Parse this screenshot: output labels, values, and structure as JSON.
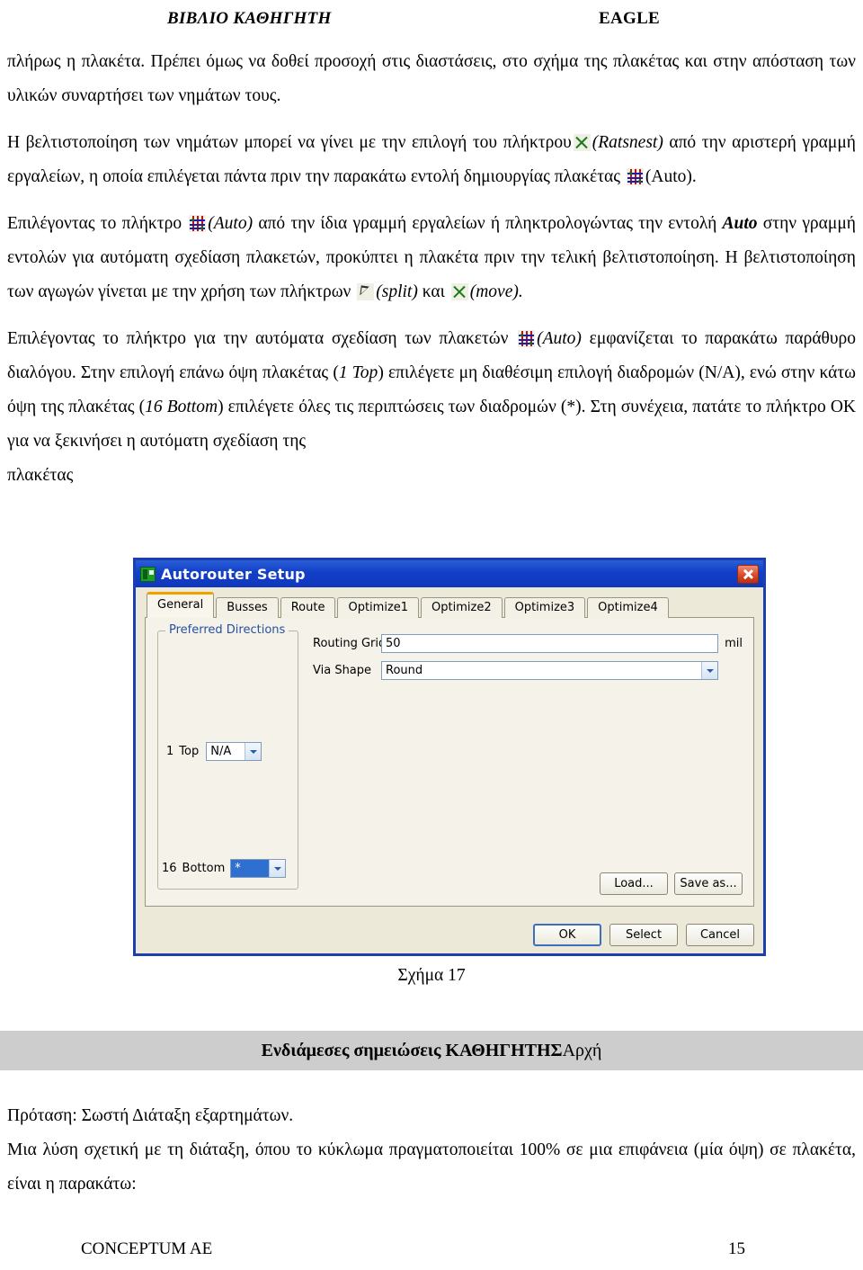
{
  "header": {
    "left": "ΒΙΒΛΙΟ ΚΑΘΗΓΗΤΗ",
    "right": "EAGLE"
  },
  "body": {
    "p1_a": "πλήρως η πλακέτα. Πρέπει όμως να δοθεί προσοχή στις διαστάσεις, στο σχήμα της πλακέτας και στην απόσταση των υλικών συναρτήσει των νημάτων τους.",
    "p2_a": "Η βελτιστοποίηση των νημάτων μπορεί να γίνει με την επιλογή του πλήκτρου",
    "p2_ratsnest": "(Ratsnest)",
    "p2_b": "από την αριστερή γραμμή εργαλείων, η οποία επιλέγεται πάντα πριν την παρακάτω εντολή δημιουργίας πλακέτας",
    "p2_auto": "(Auto).",
    "p3_a": "Επιλέγοντας το πλήκτρο",
    "p3_auto": "(Auto)",
    "p3_b": "από την ίδια γραμμή εργαλείων ή πληκτρολογώντας την εντολή",
    "p3_autoital": "Auto",
    "p3_c": "στην γραμμή εντολών για αυτόματη σχεδίαση πλακετών, προκύπτει η πλακέτα πριν την τελική βελτιστοποίηση. Η βελτιστοποίηση των αγωγών γίνεται με την χρήση των πλήκτρων",
    "p3_split": "(split)",
    "p3_kai": "και",
    "p3_move": "(move).",
    "p4_a": "Επιλέγοντας το πλήκτρο για την αυτόματα σχεδίαση των πλακετών",
    "p4_auto": "(Auto)",
    "p4_b": "εμφανίζεται το παρακάτω παράθυρο διαλόγου. Στην επιλογή επάνω όψη πλακέτας (",
    "p4_top": "1 Top",
    "p4_c": ") επιλέγετε μη διαθέσιμη επιλογή διαδρομών (N/A), ενώ στην κάτω όψη της πλακέτας  (",
    "p4_bottom": "16 Bottom",
    "p4_d": ") επιλέγετε όλες τις περιπτώσεις των διαδρομών (*). Στη συνέχεια, πατάτε το πλήκτρο OK για να ξεκινήσει η αυτόματη σχεδίαση της",
    "p4_e": "πλακέτας"
  },
  "dialog": {
    "title": "Autorouter Setup",
    "app_icon": "autorouter-icon",
    "close_icon": "close-icon",
    "tabs": [
      {
        "label": "General",
        "active": true
      },
      {
        "label": "Busses",
        "active": false
      },
      {
        "label": "Route",
        "active": false
      },
      {
        "label": "Optimize1",
        "active": false
      },
      {
        "label": "Optimize2",
        "active": false
      },
      {
        "label": "Optimize3",
        "active": false
      },
      {
        "label": "Optimize4",
        "active": false
      }
    ],
    "group": {
      "legend": "Preferred Directions",
      "layers": [
        {
          "num": "1",
          "name": "Top",
          "value": "N/A",
          "selected": false
        },
        {
          "num": "16",
          "name": "Bottom",
          "value": "*",
          "selected": true
        }
      ]
    },
    "fields": {
      "routing_grid_label": "Routing Grid",
      "routing_grid_value": "50",
      "routing_grid_unit": "mil",
      "via_shape_label": "Via Shape",
      "via_shape_value": "Round"
    },
    "buttons": {
      "load": "Load...",
      "save_as": "Save as...",
      "ok": "OK",
      "select": "Select",
      "cancel": "Cancel"
    },
    "colors": {
      "titlebar": "#1340c8",
      "frame": "#1b3fae",
      "face": "#ece9d8",
      "active_tab_accent": "#f0a000",
      "selection": "#2f6fd0"
    }
  },
  "figure_caption": "Σχήμα 17",
  "banner": {
    "strong": "Ενδιάμεσες σημειώσεις ΚΑΘΗΓΗΤΗΣ",
    "rest": " Αρχή",
    "color": "#cdcdcd"
  },
  "tail": {
    "p1": "Πρόταση: Σωστή Διάταξη εξαρτημάτων.",
    "p2": "Μια λύση σχετική με τη διάταξη, όπου το κύκλωμα πραγματοποιείται 100% σε μια επιφάνεια (μία όψη) σε πλακέτα, είναι η παρακάτω:"
  },
  "footer": {
    "left": "CONCEPTUM AE",
    "page": "15"
  }
}
